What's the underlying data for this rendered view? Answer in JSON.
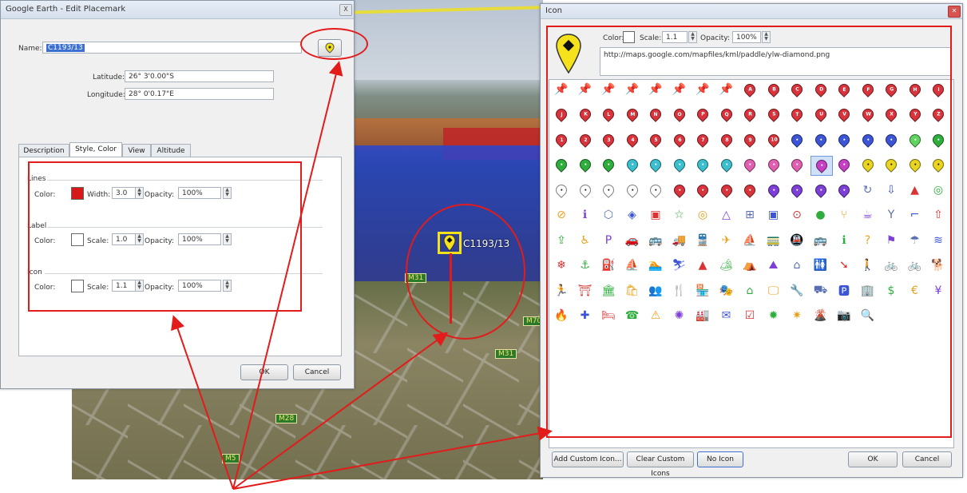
{
  "edit_placemark": {
    "title": "Google Earth - Edit Placemark",
    "close_label": "X",
    "name_label": "Name:",
    "name_value": "C1193/13",
    "latitude_label": "Latitude:",
    "latitude_value": "26° 3'0.00\"S",
    "longitude_label": "Longitude:",
    "longitude_value": "28° 0'0.17\"E",
    "tabs": [
      "Description",
      "Style, Color",
      "View",
      "Altitude"
    ],
    "lines": {
      "section": "Lines",
      "color_label": "Color:",
      "color": "#d61a1a",
      "width_label": "Width:",
      "width_value": "3.0",
      "opacity_label": "Opacity:",
      "opacity_value": "100%"
    },
    "label": {
      "section": "Label",
      "color_label": "Color:",
      "color": "#ffffff",
      "scale_label": "Scale:",
      "scale_value": "1.0",
      "opacity_label": "Opacity:",
      "opacity_value": "100%"
    },
    "icon": {
      "section": "Icon",
      "color_label": "Color:",
      "color": "#ffffff",
      "scale_label": "Scale:",
      "scale_value": "1.1",
      "opacity_label": "Opacity:",
      "opacity_value": "100%"
    },
    "ok_label": "OK",
    "cancel_label": "Cancel"
  },
  "map": {
    "placemark_label": "C1193/13",
    "road_labels": [
      "M31",
      "M31",
      "M28",
      "M5",
      "M70"
    ]
  },
  "icon_dialog": {
    "title": "Icon",
    "color_label": "Color:",
    "scale_label": "Scale:",
    "scale_value": "1.1",
    "opacity_label": "Opacity:",
    "opacity_value": "100%",
    "url": "http://maps.google.com/mapfiles/kml/paddle/ylw-diamond.png",
    "add_custom_label": "Add Custom Icon...",
    "clear_custom_label": "Clear Custom Icons",
    "no_icon_label": "No Icon",
    "ok_label": "OK",
    "cancel_label": "Cancel",
    "letter_pins": [
      "A",
      "B",
      "C",
      "D",
      "E",
      "F",
      "G",
      "H",
      "I",
      "J",
      "K",
      "L",
      "M",
      "N",
      "O",
      "P",
      "Q",
      "R",
      "S",
      "T",
      "U",
      "V",
      "W",
      "X",
      "Y",
      "Z",
      "1",
      "2",
      "3",
      "4",
      "5",
      "6",
      "7",
      "8",
      "9",
      "10"
    ]
  },
  "colors": {
    "accent_red": "#e21b1b",
    "pin_red": "#d9333b",
    "selection_blue": "#3b6fd1"
  }
}
